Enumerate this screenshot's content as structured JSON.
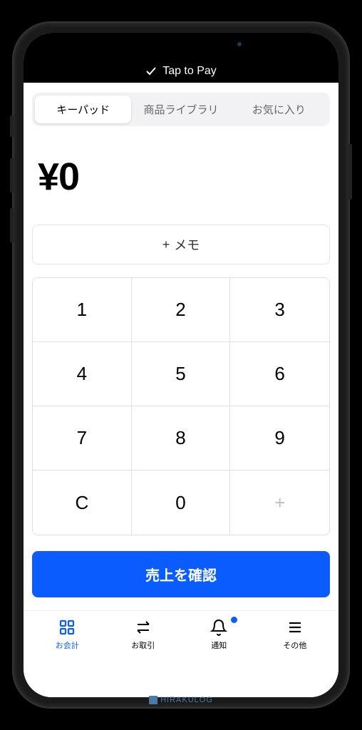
{
  "status_bar": {
    "tap_to_pay": "Tap to Pay"
  },
  "tabs": {
    "keypad": "キーパッド",
    "library": "商品ライブラリ",
    "favorites": "お気に入り"
  },
  "amount": "¥0",
  "memo": {
    "label": "メモ",
    "plus": "+"
  },
  "keypad": {
    "k1": "1",
    "k2": "2",
    "k3": "3",
    "k4": "4",
    "k5": "5",
    "k6": "6",
    "k7": "7",
    "k8": "8",
    "k9": "9",
    "kc": "C",
    "k0": "0",
    "kp": "+"
  },
  "confirm": "売上を確認",
  "nav": {
    "checkout": "お会計",
    "transactions": "お取引",
    "notifications": "通知",
    "more": "その他"
  },
  "watermark": "HIRAKULOG"
}
